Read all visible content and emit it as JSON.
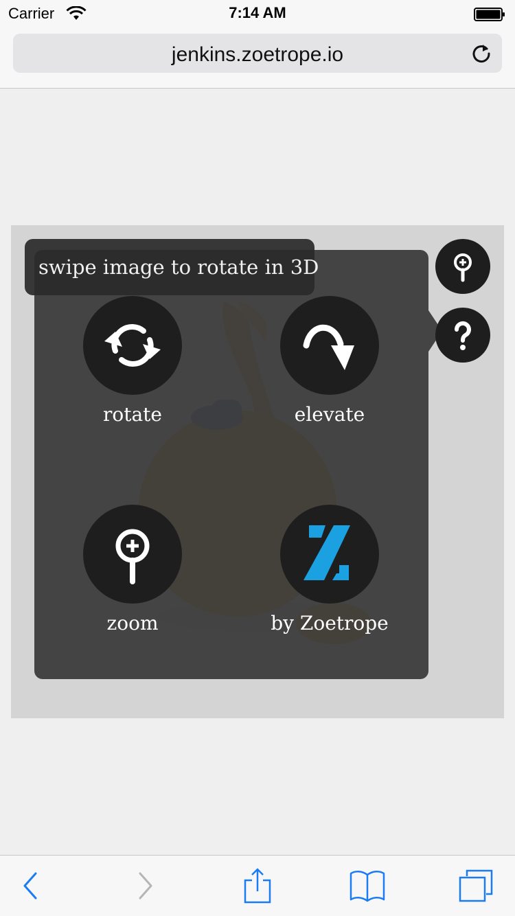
{
  "status_bar": {
    "carrier": "Carrier",
    "time": "7:14 AM"
  },
  "browser": {
    "url": "jenkins.zoetrope.io"
  },
  "viewer": {
    "tooltip": "swipe image to rotate in 3D",
    "features": [
      {
        "label": "rotate",
        "icon": "rotate-icon"
      },
      {
        "label": "elevate",
        "icon": "elevate-icon"
      },
      {
        "label": "zoom",
        "icon": "zoom-icon"
      },
      {
        "label": "by Zoetrope",
        "icon": "zoetrope-logo"
      }
    ],
    "side_buttons": [
      "zoom-icon",
      "help-icon"
    ]
  },
  "toolbar": [
    "back-icon",
    "forward-icon",
    "share-icon",
    "bookmarks-icon",
    "tabs-icon"
  ],
  "colors": {
    "ios_blue": "#1a7cf5",
    "zoetrope_blue": "#1ba1e2",
    "panel": "#3c3c3c",
    "dark_circle": "#1e1e1e"
  }
}
